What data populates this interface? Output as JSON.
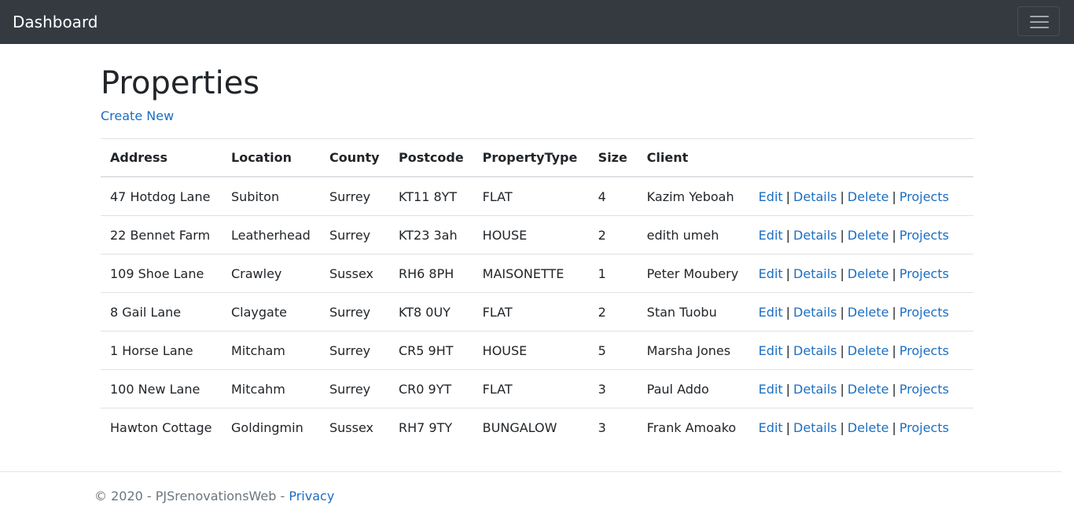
{
  "navbar": {
    "brand": "Dashboard"
  },
  "page": {
    "title": "Properties",
    "create_link": "Create New"
  },
  "table": {
    "headers": [
      "Address",
      "Location",
      "County",
      "Postcode",
      "PropertyType",
      "Size",
      "Client"
    ],
    "rows": [
      {
        "address": "47 Hotdog Lane",
        "location": "Subiton",
        "county": "Surrey",
        "postcode": "KT11 8YT",
        "type": "FLAT",
        "size": "4",
        "client": "Kazim Yeboah"
      },
      {
        "address": "22 Bennet Farm",
        "location": "Leatherhead",
        "county": "Surrey",
        "postcode": "KT23 3ah",
        "type": "HOUSE",
        "size": "2",
        "client": "edith umeh"
      },
      {
        "address": "109 Shoe Lane",
        "location": "Crawley",
        "county": "Sussex",
        "postcode": "RH6 8PH",
        "type": "MAISONETTE",
        "size": "1",
        "client": "Peter Moubery"
      },
      {
        "address": "8 Gail Lane",
        "location": "Claygate",
        "county": "Surrey",
        "postcode": "KT8 0UY",
        "type": "FLAT",
        "size": "2",
        "client": "Stan Tuobu"
      },
      {
        "address": "1 Horse Lane",
        "location": "Mitcham",
        "county": "Surrey",
        "postcode": "CR5 9HT",
        "type": "HOUSE",
        "size": "5",
        "client": "Marsha Jones"
      },
      {
        "address": "100 New Lane",
        "location": "Mitcahm",
        "county": "Surrey",
        "postcode": "CR0 9YT",
        "type": "FLAT",
        "size": "3",
        "client": "Paul Addo"
      },
      {
        "address": "Hawton Cottage",
        "location": "Goldingmin",
        "county": "Sussex",
        "postcode": "RH7 9TY",
        "type": "BUNGALOW",
        "size": "3",
        "client": "Frank Amoako"
      }
    ],
    "actions": {
      "edit": "Edit",
      "details": "Details",
      "delete": "Delete",
      "projects": "Projects",
      "separator": "|"
    }
  },
  "footer": {
    "text": "© 2020 - PJSrenovationsWeb - ",
    "privacy_link": "Privacy"
  },
  "colors": {
    "navbar_bg": "#343a40",
    "link": "#1b6ec2",
    "text": "#212529",
    "footer_text": "#6c757d"
  }
}
